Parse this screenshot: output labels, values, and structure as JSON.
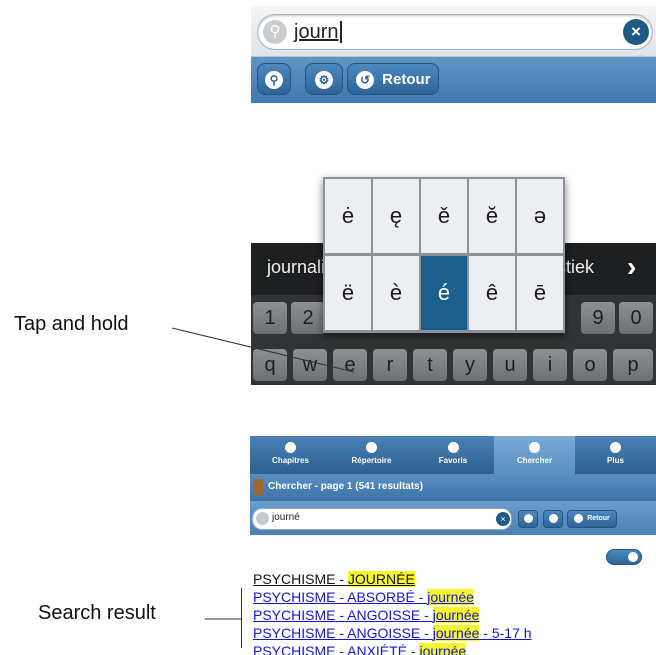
{
  "top_screenshot": {
    "search_text": "journ",
    "toolbar": {
      "retour_label": "Retour"
    },
    "suggestions": {
      "left": "journali",
      "right": "stiek",
      "arrow": "›"
    },
    "number_row": [
      "1",
      "2",
      "9",
      "0"
    ],
    "letter_row": [
      "q",
      "w",
      "e",
      "r",
      "t",
      "y",
      "u",
      "i",
      "o",
      "p"
    ],
    "accent_popup": {
      "row1": [
        "ė",
        "ę",
        "ě",
        "ĕ",
        "ə"
      ],
      "row2": [
        "ë",
        "è",
        "é",
        "ê",
        "ē"
      ],
      "selected": "é"
    },
    "colors": {
      "toolbar": "#4a84bb",
      "selected_accent": "#1c5f8c"
    }
  },
  "annotations": {
    "tap_and_hold": "Tap and hold",
    "search_result": "Search result"
  },
  "bottom_screenshot": {
    "tabs": [
      {
        "label": "Chapitres",
        "icon": "book-icon"
      },
      {
        "label": "Répertoire",
        "icon": "list-icon"
      },
      {
        "label": "Favoris",
        "icon": "star-icon"
      },
      {
        "label": "Chercher",
        "icon": "search-icon",
        "active": true
      },
      {
        "label": "Plus",
        "icon": "plus-icon"
      }
    ],
    "header_title": "Chercher - page 1 (541 resultats)",
    "search_text": "journé",
    "retour_label": "Retour",
    "results": [
      {
        "prefix": "PSYCHISME - ",
        "highlight": "JOURNÉE",
        "suffix": ""
      },
      {
        "prefix": "PSYCHISME - ABSORBÉ - ",
        "highlight": "journée",
        "suffix": ""
      },
      {
        "prefix": "PSYCHISME - ANGOISSE - ",
        "highlight": "journée",
        "suffix": ""
      },
      {
        "prefix": "PSYCHISME - ANGOISSE - ",
        "highlight": "journée",
        "suffix": " - 5-17 h"
      },
      {
        "prefix": "PSYCHISME - ANXIÉTÉ - ",
        "highlight": "journée",
        "suffix": ""
      }
    ]
  }
}
